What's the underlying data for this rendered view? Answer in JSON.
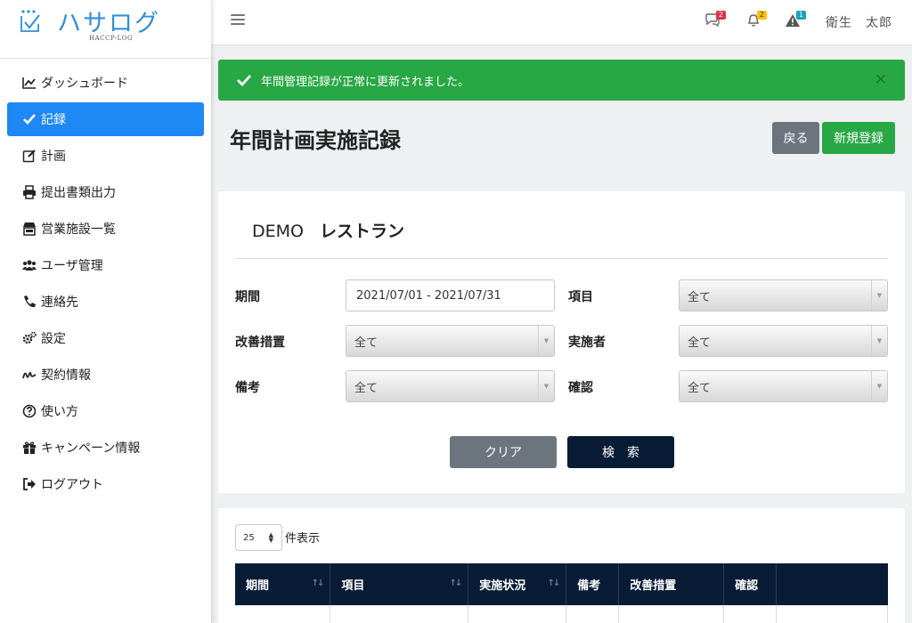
{
  "brand": {
    "name": "ハサログ",
    "sub": "HACCP-LOG"
  },
  "sidebar": {
    "items": [
      {
        "label": "ダッシュボード",
        "icon": "chart-line-icon"
      },
      {
        "label": "記録",
        "icon": "check-icon",
        "active": true
      },
      {
        "label": "計画",
        "icon": "edit-icon"
      },
      {
        "label": "提出書類出力",
        "icon": "printer-icon"
      },
      {
        "label": "営業施設一覧",
        "icon": "store-icon"
      },
      {
        "label": "ユーザ管理",
        "icon": "users-icon"
      },
      {
        "label": "連絡先",
        "icon": "phone-icon"
      },
      {
        "label": "設定",
        "icon": "gears-icon"
      },
      {
        "label": "契約情報",
        "icon": "signature-icon"
      },
      {
        "label": "使い方",
        "icon": "question-circle-icon"
      },
      {
        "label": "キャンペーン情報",
        "icon": "gift-icon"
      },
      {
        "label": "ログアウト",
        "icon": "logout-icon"
      }
    ]
  },
  "topbar": {
    "messages_badge": "2",
    "notifications_badge": "2",
    "alerts_badge": "1",
    "user_name": "衛生　太郎"
  },
  "alert": {
    "message": "年間管理記録が正常に更新されました。",
    "close": "×"
  },
  "page": {
    "title": "年間計画実施記録",
    "back_label": "戻る",
    "new_label": "新規登録"
  },
  "search": {
    "shop_prefix": "DEMO",
    "shop_name": "レストラン",
    "period_label": "期間",
    "period_value": "2021/07/01 - 2021/07/31",
    "item_label": "項目",
    "item_value": "全て",
    "improvement_label": "改善措置",
    "improvement_value": "全て",
    "executor_label": "実施者",
    "executor_value": "全て",
    "remarks_label": "備考",
    "remarks_value": "全て",
    "confirm_label": "確認",
    "confirm_value": "全て",
    "clear_label": "クリア",
    "search_label": "検索"
  },
  "list": {
    "per_page": "25",
    "per_page_label": "件表示",
    "columns": [
      "期間",
      "項目",
      "実施状況",
      "備考",
      "改善措置",
      "確認",
      ""
    ]
  },
  "colors": {
    "accent": "#1e88f5",
    "success": "#28a745",
    "dark_navy": "#081c36",
    "secondary": "#6c757d"
  }
}
